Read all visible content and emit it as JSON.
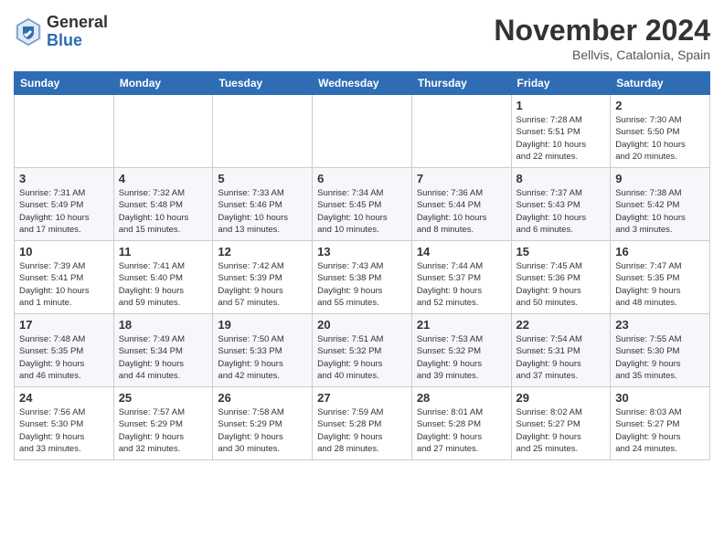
{
  "header": {
    "logo_general": "General",
    "logo_blue": "Blue",
    "title": "November 2024",
    "location": "Bellvis, Catalonia, Spain"
  },
  "columns": [
    "Sunday",
    "Monday",
    "Tuesday",
    "Wednesday",
    "Thursday",
    "Friday",
    "Saturday"
  ],
  "weeks": [
    {
      "days": [
        {
          "number": "",
          "info": ""
        },
        {
          "number": "",
          "info": ""
        },
        {
          "number": "",
          "info": ""
        },
        {
          "number": "",
          "info": ""
        },
        {
          "number": "",
          "info": ""
        },
        {
          "number": "1",
          "info": "Sunrise: 7:28 AM\nSunset: 5:51 PM\nDaylight: 10 hours\nand 22 minutes."
        },
        {
          "number": "2",
          "info": "Sunrise: 7:30 AM\nSunset: 5:50 PM\nDaylight: 10 hours\nand 20 minutes."
        }
      ]
    },
    {
      "days": [
        {
          "number": "3",
          "info": "Sunrise: 7:31 AM\nSunset: 5:49 PM\nDaylight: 10 hours\nand 17 minutes."
        },
        {
          "number": "4",
          "info": "Sunrise: 7:32 AM\nSunset: 5:48 PM\nDaylight: 10 hours\nand 15 minutes."
        },
        {
          "number": "5",
          "info": "Sunrise: 7:33 AM\nSunset: 5:46 PM\nDaylight: 10 hours\nand 13 minutes."
        },
        {
          "number": "6",
          "info": "Sunrise: 7:34 AM\nSunset: 5:45 PM\nDaylight: 10 hours\nand 10 minutes."
        },
        {
          "number": "7",
          "info": "Sunrise: 7:36 AM\nSunset: 5:44 PM\nDaylight: 10 hours\nand 8 minutes."
        },
        {
          "number": "8",
          "info": "Sunrise: 7:37 AM\nSunset: 5:43 PM\nDaylight: 10 hours\nand 6 minutes."
        },
        {
          "number": "9",
          "info": "Sunrise: 7:38 AM\nSunset: 5:42 PM\nDaylight: 10 hours\nand 3 minutes."
        }
      ]
    },
    {
      "days": [
        {
          "number": "10",
          "info": "Sunrise: 7:39 AM\nSunset: 5:41 PM\nDaylight: 10 hours\nand 1 minute."
        },
        {
          "number": "11",
          "info": "Sunrise: 7:41 AM\nSunset: 5:40 PM\nDaylight: 9 hours\nand 59 minutes."
        },
        {
          "number": "12",
          "info": "Sunrise: 7:42 AM\nSunset: 5:39 PM\nDaylight: 9 hours\nand 57 minutes."
        },
        {
          "number": "13",
          "info": "Sunrise: 7:43 AM\nSunset: 5:38 PM\nDaylight: 9 hours\nand 55 minutes."
        },
        {
          "number": "14",
          "info": "Sunrise: 7:44 AM\nSunset: 5:37 PM\nDaylight: 9 hours\nand 52 minutes."
        },
        {
          "number": "15",
          "info": "Sunrise: 7:45 AM\nSunset: 5:36 PM\nDaylight: 9 hours\nand 50 minutes."
        },
        {
          "number": "16",
          "info": "Sunrise: 7:47 AM\nSunset: 5:35 PM\nDaylight: 9 hours\nand 48 minutes."
        }
      ]
    },
    {
      "days": [
        {
          "number": "17",
          "info": "Sunrise: 7:48 AM\nSunset: 5:35 PM\nDaylight: 9 hours\nand 46 minutes."
        },
        {
          "number": "18",
          "info": "Sunrise: 7:49 AM\nSunset: 5:34 PM\nDaylight: 9 hours\nand 44 minutes."
        },
        {
          "number": "19",
          "info": "Sunrise: 7:50 AM\nSunset: 5:33 PM\nDaylight: 9 hours\nand 42 minutes."
        },
        {
          "number": "20",
          "info": "Sunrise: 7:51 AM\nSunset: 5:32 PM\nDaylight: 9 hours\nand 40 minutes."
        },
        {
          "number": "21",
          "info": "Sunrise: 7:53 AM\nSunset: 5:32 PM\nDaylight: 9 hours\nand 39 minutes."
        },
        {
          "number": "22",
          "info": "Sunrise: 7:54 AM\nSunset: 5:31 PM\nDaylight: 9 hours\nand 37 minutes."
        },
        {
          "number": "23",
          "info": "Sunrise: 7:55 AM\nSunset: 5:30 PM\nDaylight: 9 hours\nand 35 minutes."
        }
      ]
    },
    {
      "days": [
        {
          "number": "24",
          "info": "Sunrise: 7:56 AM\nSunset: 5:30 PM\nDaylight: 9 hours\nand 33 minutes."
        },
        {
          "number": "25",
          "info": "Sunrise: 7:57 AM\nSunset: 5:29 PM\nDaylight: 9 hours\nand 32 minutes."
        },
        {
          "number": "26",
          "info": "Sunrise: 7:58 AM\nSunset: 5:29 PM\nDaylight: 9 hours\nand 30 minutes."
        },
        {
          "number": "27",
          "info": "Sunrise: 7:59 AM\nSunset: 5:28 PM\nDaylight: 9 hours\nand 28 minutes."
        },
        {
          "number": "28",
          "info": "Sunrise: 8:01 AM\nSunset: 5:28 PM\nDaylight: 9 hours\nand 27 minutes."
        },
        {
          "number": "29",
          "info": "Sunrise: 8:02 AM\nSunset: 5:27 PM\nDaylight: 9 hours\nand 25 minutes."
        },
        {
          "number": "30",
          "info": "Sunrise: 8:03 AM\nSunset: 5:27 PM\nDaylight: 9 hours\nand 24 minutes."
        }
      ]
    }
  ]
}
